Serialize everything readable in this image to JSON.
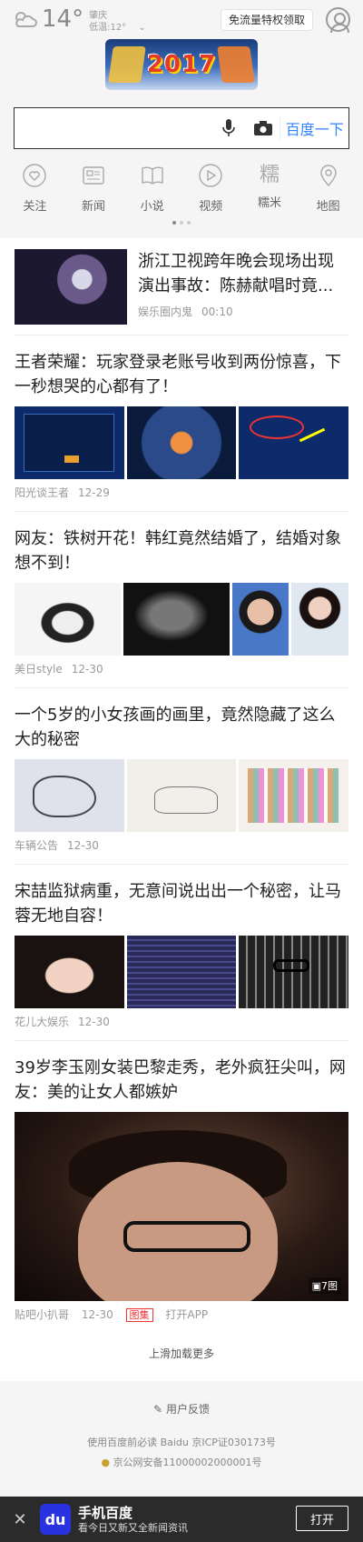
{
  "weather": {
    "temp": "14°",
    "city": "肇庆",
    "low": "低温:12°"
  },
  "promo": "免流量特权领取",
  "logo_text": "2017",
  "search": {
    "button": "百度一下",
    "placeholder": ""
  },
  "nav": [
    {
      "label": "关注",
      "icon": "heart-icon"
    },
    {
      "label": "新闻",
      "icon": "news-icon"
    },
    {
      "label": "小说",
      "icon": "book-icon"
    },
    {
      "label": "视频",
      "icon": "play-icon"
    },
    {
      "label": "糯米",
      "icon": "nuomi-icon"
    },
    {
      "label": "地图",
      "icon": "map-pin-icon"
    }
  ],
  "feed": [
    {
      "title": "浙江卫视跨年晚会现场出现演出事故：陈赫献唱时竟...",
      "source": "娱乐圈内鬼",
      "time": "00:10"
    },
    {
      "title": "王者荣耀：玩家登录老账号收到两份惊喜，下一秒想哭的心都有了！",
      "source": "阳光谈王者",
      "time": "12-29"
    },
    {
      "title": "网友：铁树开花！韩红竟然结婚了，结婚对象想不到！",
      "source": "美日style",
      "time": "12-30"
    },
    {
      "title": "一个5岁的小女孩画的画里，竟然隐藏了这么大的秘密",
      "source": "车辆公告",
      "time": "12-30"
    },
    {
      "title": "宋喆监狱病重，无意间说出出一个秘密，让马蓉无地自容！",
      "source": "花儿大娱乐",
      "time": "12-30"
    },
    {
      "title": "39岁李玉刚女装巴黎走秀，老外疯狂尖叫，网友：美的让女人都嫉妒",
      "source": "贴吧小扒哥",
      "time": "12-30",
      "tag": "图集",
      "open": "打开APP",
      "badge": "7图"
    }
  ],
  "more": "上滑加载更多",
  "footer": {
    "feedback": "用户反馈",
    "line1": "使用百度前必读 Baidu 京ICP证030173号",
    "line2": "京公网安备11000002000001号"
  },
  "banner": {
    "app_title": "手机百度",
    "app_sub": "看今日又新又全新闻资讯",
    "open": "打开",
    "close": "✕",
    "app_icon_text": "du"
  }
}
